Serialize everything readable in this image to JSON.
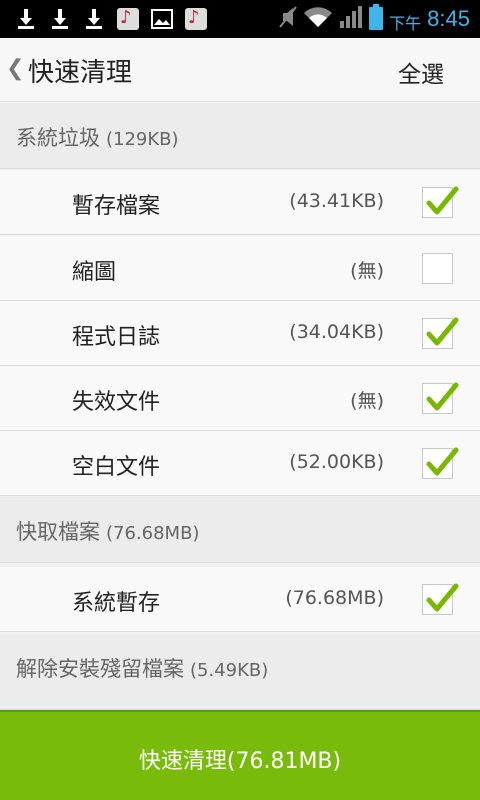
{
  "status_bar": {
    "time_prefix": "下午",
    "time": "8:45",
    "icons": [
      "download-icon",
      "download-icon",
      "download-icon",
      "music-app-icon",
      "image-icon",
      "music-app-icon",
      "mute-icon",
      "wifi-icon",
      "signal-icon",
      "battery-icon"
    ]
  },
  "header": {
    "back_symbol": "❮",
    "title": "快速清理",
    "select_all": "全選"
  },
  "sections": [
    {
      "label": "系統垃圾",
      "size": "(129KB)"
    },
    {
      "label": "快取檔案",
      "size": "(76.68MB)"
    },
    {
      "label": "解除安裝殘留檔案",
      "size": "(5.49KB)"
    }
  ],
  "rows": [
    {
      "name": "暫存檔案",
      "size": "(43.41KB)",
      "checked": true
    },
    {
      "name": "縮圖",
      "size": "(無)",
      "checked": false
    },
    {
      "name": "程式日誌",
      "size": "(34.04KB)",
      "checked": true
    },
    {
      "name": "失效文件",
      "size": "(無)",
      "checked": true
    },
    {
      "name": "空白文件",
      "size": "(52.00KB)",
      "checked": true
    },
    {
      "name": "系統暫存",
      "size": "(76.68MB)",
      "checked": true
    }
  ],
  "action": {
    "clean_label": "快速清理(76.81MB)"
  },
  "colors": {
    "accent_green": "#79bb0a",
    "check_green": "#78b800",
    "status_blue": "#3fb4ea"
  }
}
